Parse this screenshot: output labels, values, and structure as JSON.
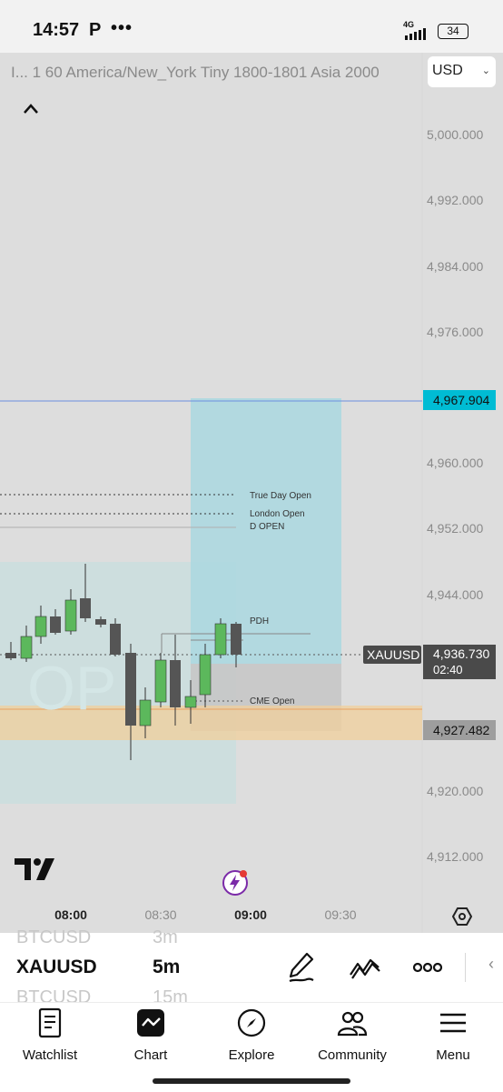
{
  "status_bar": {
    "time": "14:57",
    "app_letter": "P",
    "dots": "•••",
    "network": "4G",
    "battery": "34"
  },
  "chart_header": {
    "indicator_text": "I... 1 60 America/New_York Tiny 1800-1801 Asia 2000",
    "currency": "USD"
  },
  "price_axis": {
    "ticks": [
      "5,000.000",
      "4,992.000",
      "4,984.000",
      "4,976.000",
      "4,960.000",
      "4,952.000",
      "4,944.000",
      "4,920.000",
      "4,912.000"
    ],
    "blue_line_price": "4,967.904",
    "symbol_tag": "XAUUSD",
    "last_price": "4,936.730",
    "countdown": "02:40",
    "level_price": "4,927.482"
  },
  "levels": {
    "true_day_open": "True Day Open",
    "london_open": "London Open",
    "d_open": "D OPEN",
    "pdh": "PDH",
    "cme_open": "CME Open",
    "watermark": "OP"
  },
  "time_axis": {
    "ticks": [
      "08:00",
      "08:30",
      "09:00",
      "09:30"
    ]
  },
  "symbol_panel": {
    "prev_symbol": "BTCUSD",
    "prev_tf": "3m",
    "current_symbol": "XAUUSD",
    "current_tf": "5m",
    "next_symbol": "BTCUSD",
    "next_tf": "15m",
    "collapse_glyph": "‹"
  },
  "nav": {
    "watchlist": "Watchlist",
    "chart": "Chart",
    "explore": "Explore",
    "community": "Community",
    "menu": "Menu"
  },
  "colors": {
    "chart_bg": "#dddddd",
    "bull_candle": "#5cb85c",
    "bear_candle": "#555555",
    "price_tag": "#00bcd4",
    "blue_line": "#6c8fe0"
  }
}
